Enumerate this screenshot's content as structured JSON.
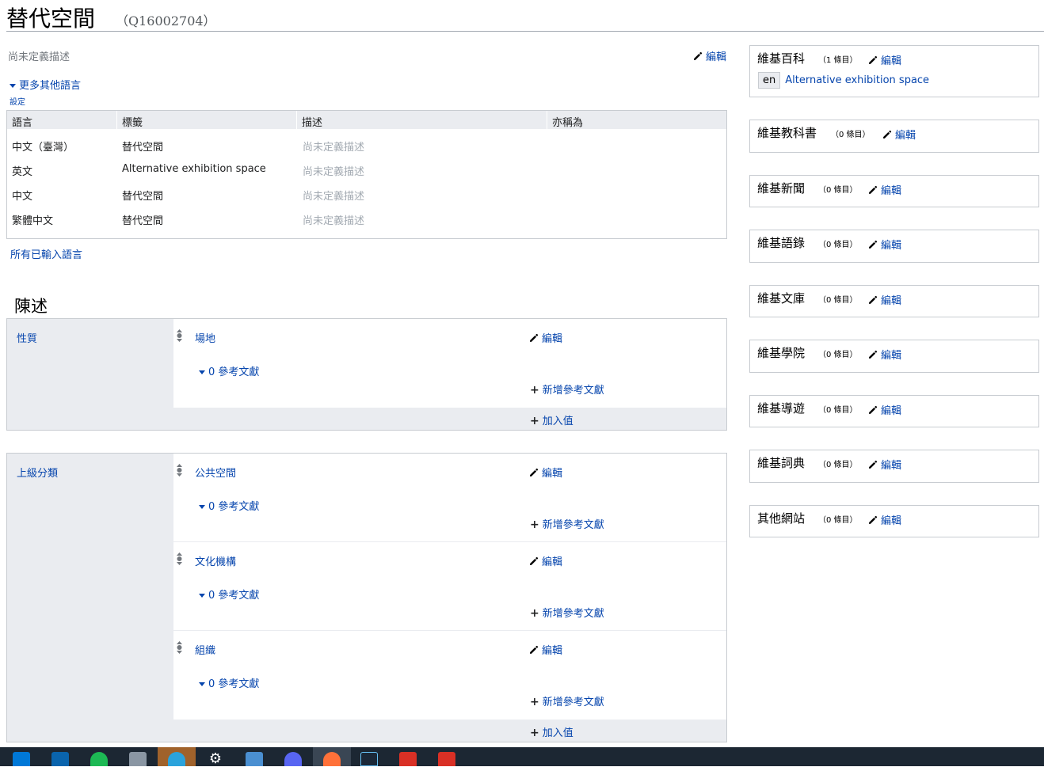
{
  "header": {
    "title": "替代空間",
    "qid": "（Q16002704）"
  },
  "description": {
    "empty_text": "尚未定義描述",
    "edit_label": "編輯"
  },
  "languages": {
    "more_label": "更多其他語言",
    "settings_label": "設定",
    "columns": [
      "語言",
      "標籤",
      "描述",
      "亦稱為"
    ],
    "rows": [
      {
        "lang": "中文（臺灣）",
        "label": "替代空間",
        "desc": "尚未定義描述",
        "aliases": ""
      },
      {
        "lang": "英文",
        "label": "Alternative exhibition space",
        "desc": "尚未定義描述",
        "aliases": ""
      },
      {
        "lang": "中文",
        "label": "替代空間",
        "desc": "尚未定義描述",
        "aliases": ""
      },
      {
        "lang": "繁體中文",
        "label": "替代空間",
        "desc": "尚未定義描述",
        "aliases": ""
      }
    ],
    "all_languages_label": "所有已輸入語言"
  },
  "statements": {
    "heading": "陳述",
    "groups": [
      {
        "property": "性質",
        "values": [
          {
            "value": "場地",
            "refs": "0 參考文獻",
            "edit": "編輯",
            "add_ref": "新增參考文獻"
          }
        ],
        "add_value": "加入值"
      },
      {
        "property": "上級分類",
        "values": [
          {
            "value": "公共空間",
            "refs": "0 參考文獻",
            "edit": "編輯",
            "add_ref": "新增參考文獻"
          },
          {
            "value": "文化機構",
            "refs": "0 參考文獻",
            "edit": "編輯",
            "add_ref": "新增參考文獻"
          },
          {
            "value": "組織",
            "refs": "0 參考文獻",
            "edit": "編輯",
            "add_ref": "新增參考文獻"
          }
        ],
        "add_value": "加入值"
      }
    ]
  },
  "sitelinks": [
    {
      "title": "維基百科",
      "count": "（1 條目）",
      "edit": "編輯",
      "links": [
        {
          "lang": "en",
          "title": "Alternative exhibition space"
        }
      ]
    },
    {
      "title": "維基教科書",
      "count": "（0 條目）",
      "edit": "編輯"
    },
    {
      "title": "維基新聞",
      "count": "（0 條目）",
      "edit": "編輯"
    },
    {
      "title": "維基語錄",
      "count": "（0 條目）",
      "edit": "編輯"
    },
    {
      "title": "維基文庫",
      "count": "（0 條目）",
      "edit": "編輯"
    },
    {
      "title": "維基學院",
      "count": "（0 條目）",
      "edit": "編輯"
    },
    {
      "title": "維基導遊",
      "count": "（0 條目）",
      "edit": "編輯"
    },
    {
      "title": "維基詞典",
      "count": "（0 條目）",
      "edit": "編輯"
    },
    {
      "title": "其他網站",
      "count": "（0 條目）",
      "edit": "編輯"
    }
  ],
  "taskbar": {
    "icons": [
      "windows-start-icon",
      "mail-icon",
      "spotify-icon",
      "photos-icon",
      "telegram-icon",
      "settings-icon",
      "control-panel-icon",
      "discord-icon",
      "firefox-icon",
      "steam-icon",
      "pdf-icon",
      "pdf-icon"
    ],
    "colors": {
      "bg": "#1c2733",
      "spotify": "#1db954",
      "telegram": "#2aa3dc",
      "discord": "#5865f2",
      "pdf": "#d93025"
    }
  }
}
